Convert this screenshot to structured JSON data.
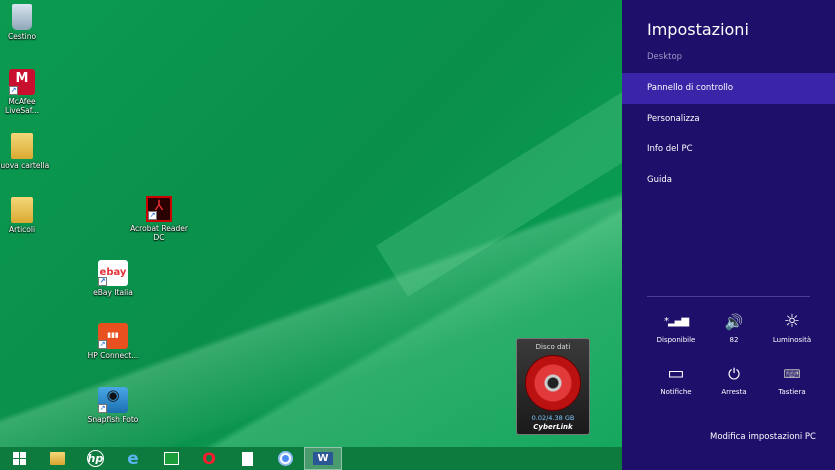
{
  "desktop": {
    "icons": [
      {
        "label": "Cestino"
      },
      {
        "label": "McAfee LiveSaf..."
      },
      {
        "label": "Nuova cartella"
      },
      {
        "label": "Articoli"
      },
      {
        "label": "Acrobat Reader DC"
      },
      {
        "label": "ebay",
        "caption": "eBay Italia"
      },
      {
        "label": "HP Connect..."
      },
      {
        "label": "Snapfish Foto"
      }
    ],
    "disc_widget": {
      "title": "Disco dati",
      "size": "0.02/4.38 GB",
      "brand": "CyberLink"
    }
  },
  "taskbar": {
    "items": [
      {
        "icon": "windows-start-icon"
      },
      {
        "icon": "file-explorer-icon"
      },
      {
        "icon": "hp-icon",
        "glyph": "hp"
      },
      {
        "icon": "internet-explorer-icon",
        "glyph": "e"
      },
      {
        "icon": "store-icon"
      },
      {
        "icon": "opera-icon",
        "glyph": "O"
      },
      {
        "icon": "document-icon"
      },
      {
        "icon": "chrome-icon"
      },
      {
        "icon": "word-icon",
        "glyph": "W"
      }
    ]
  },
  "settings": {
    "title": "Impostazioni",
    "subtitle": "Desktop",
    "menu": [
      {
        "label": "Pannello di controllo"
      },
      {
        "label": "Personalizza"
      },
      {
        "label": "Info del PC"
      },
      {
        "label": "Guida"
      }
    ],
    "quick": [
      {
        "icon": "network-icon",
        "glyph": "*▂▄▆",
        "label": "Disponibile"
      },
      {
        "icon": "volume-icon",
        "glyph": "🔊",
        "label": "82"
      },
      {
        "icon": "brightness-icon",
        "glyph": "☼",
        "label": "Luminosità"
      },
      {
        "icon": "notifications-icon",
        "glyph": "▭",
        "label": "Notifiche"
      },
      {
        "icon": "power-icon",
        "glyph": "⏻",
        "label": "Arresta"
      },
      {
        "icon": "keyboard-icon",
        "glyph": "⌨",
        "label": "Tastiera"
      }
    ],
    "link": "Modifica impostazioni PC"
  }
}
